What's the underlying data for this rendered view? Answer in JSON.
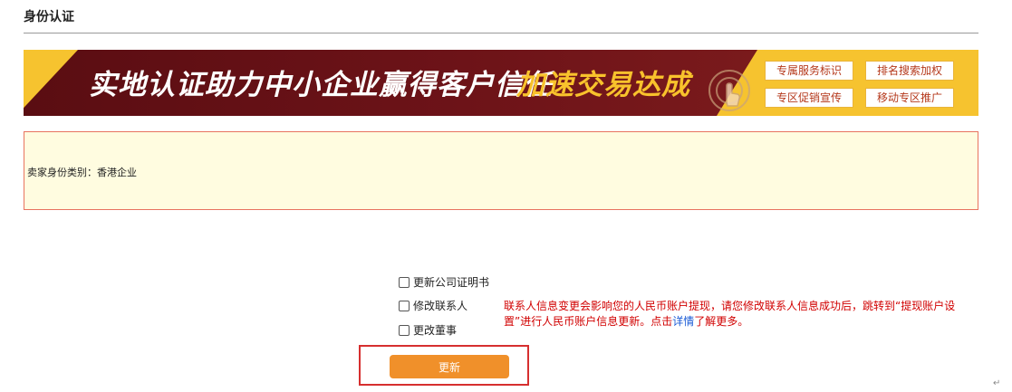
{
  "page": {
    "title": "身份认证"
  },
  "banner": {
    "slogan_main": "实地认证助力中小企业赢得客户信任",
    "slogan_accent": "加速交易达成",
    "tags": [
      "专属服务标识",
      "排名搜索加权",
      "专区促销宣传",
      "移动专区推广"
    ],
    "icon": "touch-hand-icon",
    "colors": {
      "dark": "#6d1318",
      "yellow": "#f6c32f",
      "accent_text": "#f8c22c"
    }
  },
  "identity": {
    "text": "卖家身份类别：香港企业"
  },
  "options": [
    {
      "label": "更新公司证明书",
      "checked": false
    },
    {
      "label": "修改联系人",
      "checked": false
    },
    {
      "label": "更改董事",
      "checked": false
    }
  ],
  "notice": {
    "before_link": "联系人信息变更会影响您的人民币账户提现，请您修改联系人信息成功后，跳转到“提现账户设置”进行人民币账户信息更新。点击",
    "link": "详情",
    "after_link": "了解更多。",
    "color": "#d10000"
  },
  "actions": {
    "update_label": "更新",
    "button_color": "#f0902a",
    "highlight_color": "#d62f2f"
  },
  "misc": {
    "return_mark": "↵"
  }
}
